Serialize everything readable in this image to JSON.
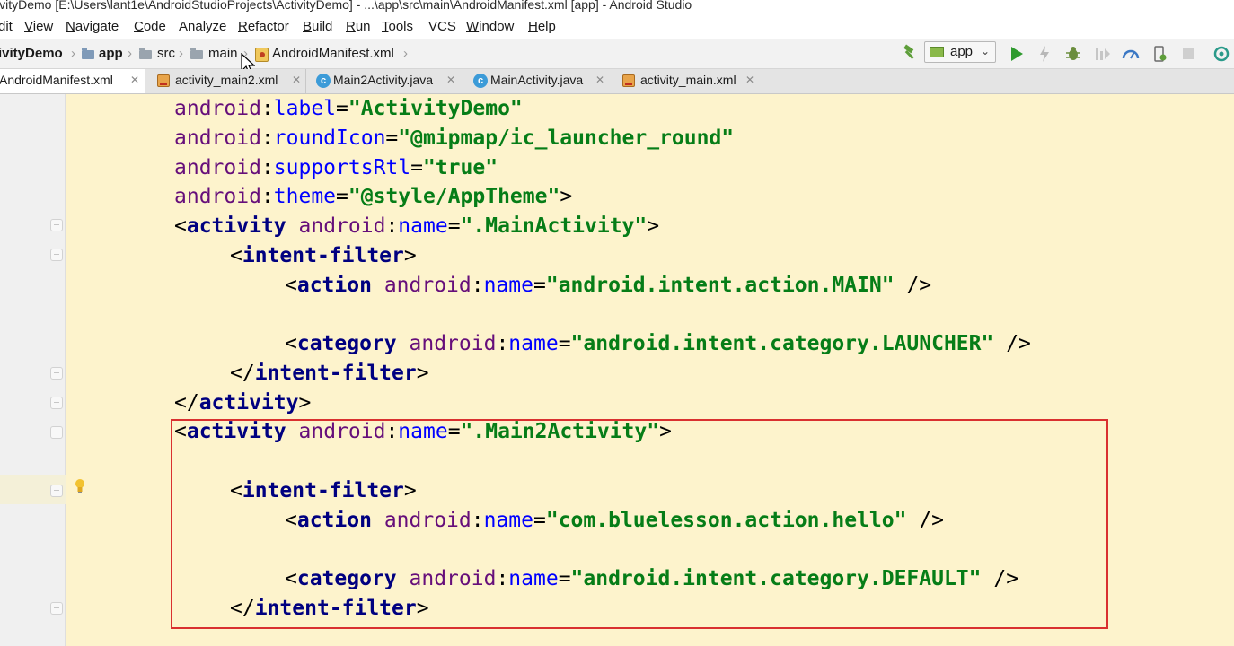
{
  "window": {
    "title": "ivityDemo [E:\\Users\\lant1e\\AndroidStudioProjects\\ActivityDemo] - ...\\app\\src\\main\\AndroidManifest.xml [app] - Android Studio"
  },
  "menu": [
    {
      "mnemonic": "",
      "rest": "dit"
    },
    {
      "mnemonic": "V",
      "rest": "iew"
    },
    {
      "mnemonic": "N",
      "rest": "avigate"
    },
    {
      "mnemonic": "C",
      "rest": "ode"
    },
    {
      "mnemonic": "",
      "rest": "Analyze"
    },
    {
      "mnemonic": "R",
      "rest": "efactor"
    },
    {
      "mnemonic": "B",
      "rest": "uild"
    },
    {
      "mnemonic": "R",
      "rest": "un"
    },
    {
      "mnemonic": "T",
      "rest": "ools"
    },
    {
      "mnemonic": "",
      "rest": "VCS"
    },
    {
      "mnemonic": "W",
      "rest": "indow"
    },
    {
      "mnemonic": "H",
      "rest": "elp"
    }
  ],
  "breadcrumb": {
    "project": "ivityDemo",
    "module": "app",
    "src": "src",
    "main": "main",
    "file": "AndroidManifest.xml"
  },
  "toolbar": {
    "run_config": "app",
    "icons": [
      "hammer-icon",
      "run-icon",
      "apply-changes-icon",
      "debug-icon",
      "coverage-icon",
      "profile-icon",
      "attach-debugger-icon",
      "stop-icon",
      "sync-icon"
    ]
  },
  "tabs": [
    {
      "label": "AndroidManifest.xml",
      "icon": "manifest",
      "active": true
    },
    {
      "label": "activity_main2.xml",
      "icon": "xml",
      "active": false
    },
    {
      "label": "Main2Activity.java",
      "icon": "class",
      "active": false
    },
    {
      "label": "MainActivity.java",
      "icon": "class",
      "active": false
    },
    {
      "label": "activity_main.xml",
      "icon": "xml",
      "active": false
    }
  ],
  "code": {
    "lines": [
      [
        {
          "t": "ns",
          "v": "android"
        },
        {
          "t": "punc",
          "v": ":"
        },
        {
          "t": "attr",
          "v": "label"
        },
        {
          "t": "punc",
          "v": "="
        },
        {
          "t": "str",
          "v": "\"ActivityDemo\""
        }
      ],
      [
        {
          "t": "ns",
          "v": "android"
        },
        {
          "t": "punc",
          "v": ":"
        },
        {
          "t": "attr",
          "v": "roundIcon"
        },
        {
          "t": "punc",
          "v": "="
        },
        {
          "t": "str",
          "v": "\"@mipmap/ic_launcher_round\""
        }
      ],
      [
        {
          "t": "ns",
          "v": "android"
        },
        {
          "t": "punc",
          "v": ":"
        },
        {
          "t": "attr",
          "v": "supportsRtl"
        },
        {
          "t": "punc",
          "v": "="
        },
        {
          "t": "str",
          "v": "\"true\""
        }
      ],
      [
        {
          "t": "ns",
          "v": "android"
        },
        {
          "t": "punc",
          "v": ":"
        },
        {
          "t": "attr",
          "v": "theme"
        },
        {
          "t": "punc",
          "v": "="
        },
        {
          "t": "str",
          "v": "\"@style/AppTheme\""
        },
        {
          "t": "punc",
          "v": ">"
        }
      ],
      [
        {
          "t": "punc",
          "v": "<"
        },
        {
          "t": "tag",
          "v": "activity"
        },
        {
          "t": "punc",
          "v": " "
        },
        {
          "t": "ns",
          "v": "android"
        },
        {
          "t": "punc",
          "v": ":"
        },
        {
          "t": "attr",
          "v": "name"
        },
        {
          "t": "punc",
          "v": "="
        },
        {
          "t": "str",
          "v": "\".MainActivity\""
        },
        {
          "t": "punc",
          "v": ">"
        }
      ],
      [
        {
          "t": "punc",
          "v": "<"
        },
        {
          "t": "tag",
          "v": "intent-filter"
        },
        {
          "t": "punc",
          "v": ">"
        }
      ],
      [
        {
          "t": "punc",
          "v": "<"
        },
        {
          "t": "tag",
          "v": "action"
        },
        {
          "t": "punc",
          "v": " "
        },
        {
          "t": "ns",
          "v": "android"
        },
        {
          "t": "punc",
          "v": ":"
        },
        {
          "t": "attr",
          "v": "name"
        },
        {
          "t": "punc",
          "v": "="
        },
        {
          "t": "str",
          "v": "\"android.intent.action.MAIN\""
        },
        {
          "t": "punc",
          "v": " />"
        }
      ],
      [],
      [
        {
          "t": "punc",
          "v": "<"
        },
        {
          "t": "tag",
          "v": "category"
        },
        {
          "t": "punc",
          "v": " "
        },
        {
          "t": "ns",
          "v": "android"
        },
        {
          "t": "punc",
          "v": ":"
        },
        {
          "t": "attr",
          "v": "name"
        },
        {
          "t": "punc",
          "v": "="
        },
        {
          "t": "str",
          "v": "\"android.intent.category.LAUNCHER\""
        },
        {
          "t": "punc",
          "v": " />"
        }
      ],
      [
        {
          "t": "punc",
          "v": "</"
        },
        {
          "t": "tag",
          "v": "intent-filter"
        },
        {
          "t": "punc",
          "v": ">"
        }
      ],
      [
        {
          "t": "punc",
          "v": "</"
        },
        {
          "t": "tag",
          "v": "activity"
        },
        {
          "t": "punc",
          "v": ">"
        }
      ],
      [
        {
          "t": "punc",
          "v": "<"
        },
        {
          "t": "tag",
          "v": "activity"
        },
        {
          "t": "punc",
          "v": " "
        },
        {
          "t": "ns",
          "v": "android"
        },
        {
          "t": "punc",
          "v": ":"
        },
        {
          "t": "attr",
          "v": "name"
        },
        {
          "t": "punc",
          "v": "="
        },
        {
          "t": "str",
          "v": "\".Main2Activity\""
        },
        {
          "t": "punc",
          "v": ">"
        }
      ],
      [],
      [
        {
          "t": "punc",
          "v": "<"
        },
        {
          "t": "tag",
          "v": "intent-filter"
        },
        {
          "t": "punc",
          "v": ">"
        }
      ],
      [
        {
          "t": "punc",
          "v": "<"
        },
        {
          "t": "tag",
          "v": "action"
        },
        {
          "t": "punc",
          "v": " "
        },
        {
          "t": "ns",
          "v": "android"
        },
        {
          "t": "punc",
          "v": ":"
        },
        {
          "t": "attr",
          "v": "name"
        },
        {
          "t": "punc",
          "v": "="
        },
        {
          "t": "str",
          "v": "\"com.bluelesson.action.hello\""
        },
        {
          "t": "punc",
          "v": " />"
        }
      ],
      [],
      [
        {
          "t": "punc",
          "v": "<"
        },
        {
          "t": "tag",
          "v": "category"
        },
        {
          "t": "punc",
          "v": " "
        },
        {
          "t": "ns",
          "v": "android"
        },
        {
          "t": "punc",
          "v": ":"
        },
        {
          "t": "attr",
          "v": "name"
        },
        {
          "t": "punc",
          "v": "="
        },
        {
          "t": "str",
          "v": "\"android.intent.category.DEFAULT\""
        },
        {
          "t": "punc",
          "v": " />"
        }
      ],
      [
        {
          "t": "punc",
          "v": "</"
        },
        {
          "t": "tag",
          "v": "intent-filter"
        },
        {
          "t": "punc",
          "v": ">"
        }
      ]
    ]
  },
  "colors": {
    "editor_background": "#fdf3cc",
    "namespace": "#660e7a",
    "attribute": "#0000ff",
    "string": "#067d17",
    "tag": "#000080",
    "highlight_box": "#d93030"
  }
}
